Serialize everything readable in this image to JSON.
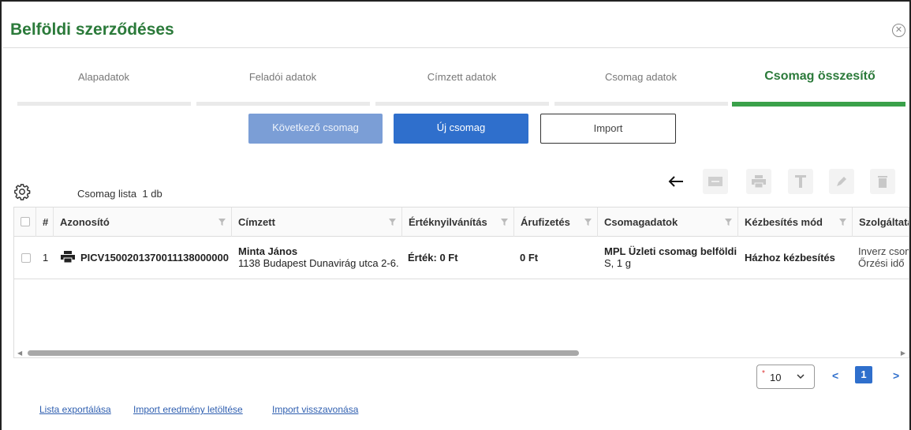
{
  "dialog": {
    "title": "Belföldi szerződéses"
  },
  "tabs": [
    {
      "label": "Alapadatok",
      "active": false
    },
    {
      "label": "Feladói adatok",
      "active": false
    },
    {
      "label": "Címzett adatok",
      "active": false
    },
    {
      "label": "Csomag adatok",
      "active": false
    },
    {
      "label": "Csomag összesítő",
      "active": true
    }
  ],
  "actions": {
    "next_package": "Következő csomag",
    "new_package": "Új csomag",
    "import": "Import"
  },
  "list": {
    "label": "Csomag lista",
    "count": "1 db"
  },
  "toolbar": [
    "back-arrow-icon",
    "barcode-icon",
    "print-icon",
    "text-icon",
    "edit-icon",
    "delete-icon"
  ],
  "table": {
    "columns": [
      "#",
      "Azonosító",
      "Címzett",
      "Értéknyilvánítás",
      "Árufizetés",
      "Csomagadatok",
      "Kézbesítés mód",
      "Szolgáltatá"
    ],
    "rows": [
      {
        "num": "1",
        "id": "PICV1500201370011138000000",
        "recipient_name": "Minta János",
        "recipient_address": "1138 Budapest Dunavirág utca 2-6.",
        "declared_value": "Érték: 0 Ft",
        "cod": "0 Ft",
        "package_type": "MPL Üzleti csomag belföldi",
        "package_size": "S, 1 g",
        "delivery_mode": "Házhoz kézbesítés",
        "service_line1": "Inverz csom",
        "service_line2": "Őrzési idő"
      }
    ]
  },
  "pagination": {
    "page_size": "10",
    "required_mark": "*",
    "prev": "<",
    "current": "1",
    "next": ">"
  },
  "footer_links": {
    "export": "Lista exportálása",
    "download_import_result": "Import eredmény letöltése",
    "undo_import": "Import visszavonása"
  },
  "colors": {
    "title_green": "#2b7a3a",
    "active_tab_bar": "#3aa14a",
    "primary_blue": "#2f6fcc",
    "disabled_blue": "#7b9ed6"
  }
}
